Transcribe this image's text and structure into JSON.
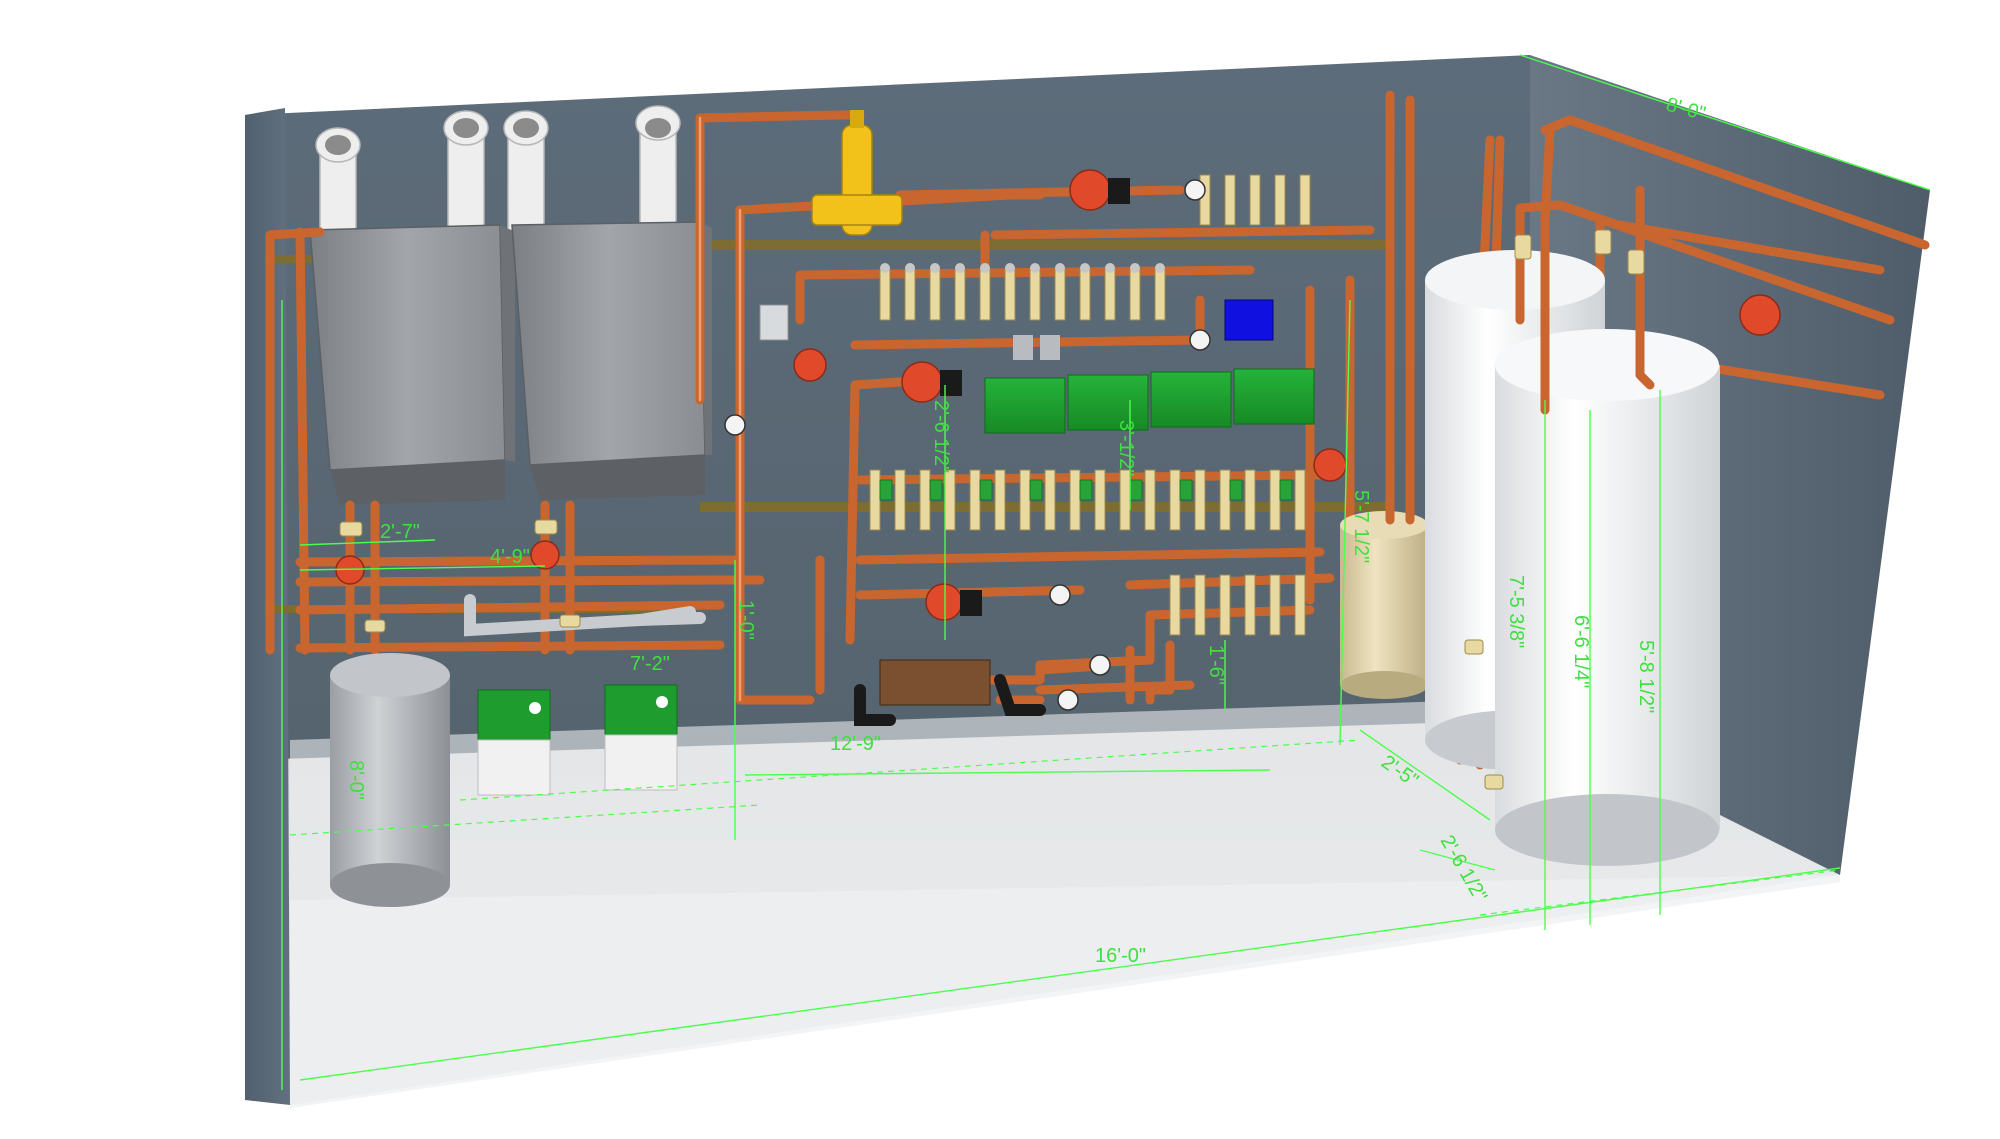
{
  "dimensions": {
    "room_length": "16'-0\"",
    "room_depth_top": "8'-0\"",
    "room_height_left": "8'-0\"",
    "boiler_spacing": "2'-7\"",
    "boiler_span": "4'-9\"",
    "unit_height": "7'-2\"",
    "floor_to_manifold": "1'-0\"",
    "panel_width": "12'-9\"",
    "manifold_height_a": "2'-6 1/2\"",
    "manifold_height_b": "3'-1/2\"",
    "expansion_height": "5'-7 1/2\"",
    "low_manifold": "1'-6\"",
    "tank_offset_a": "2'-5\"",
    "tank_offset_b": "2'-6 1/2\"",
    "tank_height_a": "7'-5 3/8\"",
    "tank_height_b": "6'-6 1/4\"",
    "tank_height_c": "5'-8 1/2\""
  },
  "colors": {
    "wall": "#5a6a7a",
    "floor": "#e4e6e8",
    "copper": "#c9662f",
    "boiler": "#8e9195",
    "control_green": "#1c9e2b",
    "dimension": "#3fe03f",
    "pump": "#e0492a",
    "separator": "#f2c21a",
    "control_blue": "#1010e0"
  }
}
